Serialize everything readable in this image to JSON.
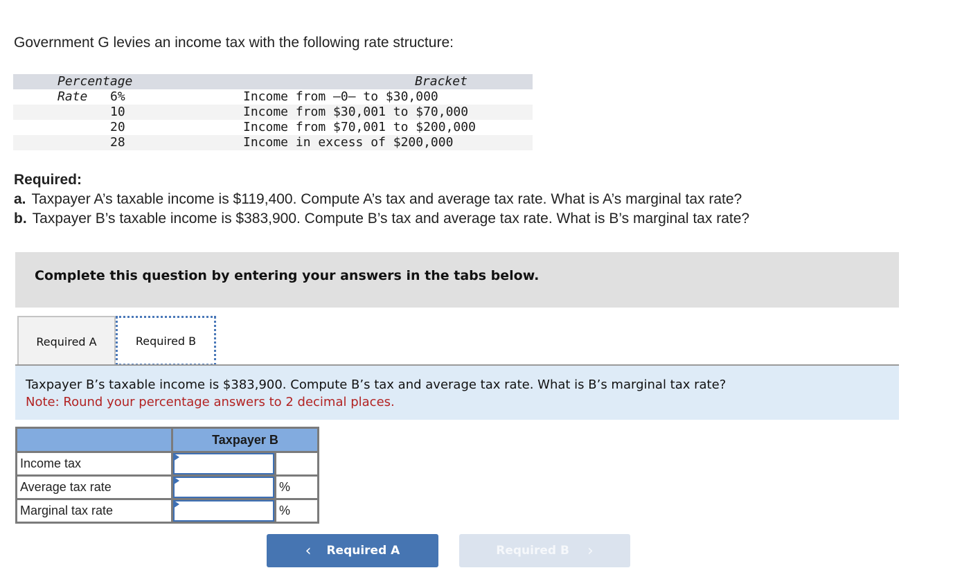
{
  "intro": "Government G levies an income tax with the following rate structure:",
  "rate_table": {
    "headers": {
      "rate": "Percentage Rate",
      "bracket": "Bracket"
    },
    "rows": [
      {
        "rate": "6%",
        "bracket": "Income from –0– to $30,000"
      },
      {
        "rate": "10",
        "bracket": "Income from $30,001 to $70,000"
      },
      {
        "rate": "20",
        "bracket": "Income from $70,001 to $200,000"
      },
      {
        "rate": "28",
        "bracket": "Income in excess of $200,000"
      }
    ]
  },
  "required": {
    "title": "Required:",
    "items": [
      {
        "marker": "a.",
        "text": "Taxpayer A’s taxable income is $119,400. Compute A’s tax and average tax rate. What is A’s marginal tax rate?"
      },
      {
        "marker": "b.",
        "text": "Taxpayer B’s taxable income is $383,900. Compute B’s tax and average tax rate. What is B’s marginal tax rate?"
      }
    ]
  },
  "banner": "Complete this question by entering your answers in the tabs below.",
  "tabs": [
    {
      "label": "Required A",
      "active": false
    },
    {
      "label": "Required B",
      "active": true
    }
  ],
  "panel": {
    "question": "Taxpayer B’s taxable income is $383,900. Compute B’s tax and average tax rate. What is B’s marginal tax rate?",
    "note": "Note: Round your percentage answers to 2 decimal places."
  },
  "answer_table": {
    "column_header": "Taxpayer B",
    "rows": [
      {
        "label": "Income tax",
        "value": "",
        "unit": ""
      },
      {
        "label": "Average tax rate",
        "value": "",
        "unit": "%"
      },
      {
        "label": "Marginal tax rate",
        "value": "",
        "unit": "%"
      }
    ]
  },
  "nav": {
    "prev_label": "Required A",
    "next_label": "Required B",
    "prev_icon": "‹",
    "next_icon": "›"
  },
  "colors": {
    "accent": "#4675b2",
    "header_blue": "#82abdf",
    "panel_bg": "#deebf7",
    "note_red": "#b22222"
  }
}
